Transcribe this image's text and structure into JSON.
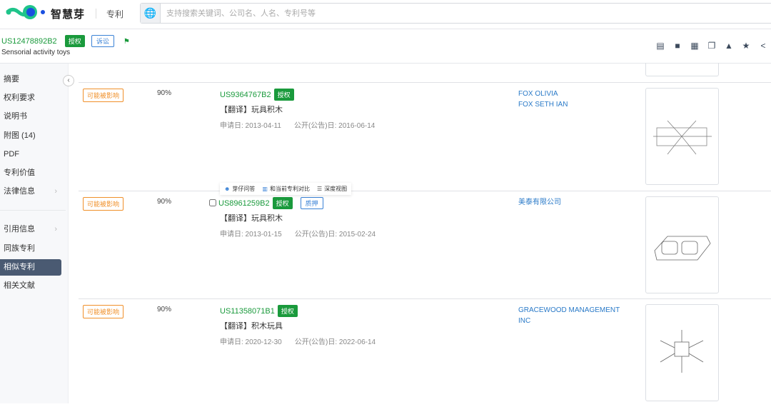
{
  "header": {
    "brand": "智慧芽",
    "nav": "专利",
    "search_placeholder": "支持搜索关键词、公司名、人名、专利号等"
  },
  "patent": {
    "number": "US12478892B2",
    "status": "授权",
    "badge": "诉讼",
    "title": "Sensorial activity toys"
  },
  "toolbar": [
    "pdf-download-icon",
    "folder-icon",
    "calendar-icon",
    "copy-icon",
    "upload-icon",
    "star-icon",
    "share-icon"
  ],
  "sidebar": {
    "items": [
      {
        "label": "摘要"
      },
      {
        "label": "权利要求"
      },
      {
        "label": "说明书"
      },
      {
        "label": "附图 (14)"
      },
      {
        "label": "PDF"
      },
      {
        "label": "专利价值"
      },
      {
        "label": "法律信息"
      },
      {
        "label": "引用信息"
      },
      {
        "label": "同族专利"
      },
      {
        "label": "相似专利"
      },
      {
        "label": "相关文献"
      }
    ]
  },
  "tooltip": {
    "qa": "芽仔问答",
    "compare": "和当前专利对比",
    "deep": "深度视图"
  },
  "results": [
    {
      "impact": "可能被影响",
      "similarity": "90%",
      "number": "US9364767B2",
      "status": "授权",
      "title": "【翻译】玩具积木",
      "app_date": "申请日: 2013-04-11",
      "pub_date": "公开(公告)日: 2016-06-14",
      "assignee": "FOX OLIVIA",
      "assignee2": "FOX SETH IAN"
    },
    {
      "impact": "可能被影响",
      "similarity": "90%",
      "number": "US8961259B2",
      "status": "授权",
      "badge": "质押",
      "title": "【翻译】玩具积木",
      "app_date": "申请日: 2013-01-15",
      "pub_date": "公开(公告)日: 2015-02-24",
      "assignee": "美泰有限公司"
    },
    {
      "impact": "可能被影响",
      "similarity": "90%",
      "number": "US11358071B1",
      "status": "授权",
      "title": "【翻译】积木玩具",
      "app_date": "申请日: 2020-12-30",
      "pub_date": "公开(公告)日: 2022-06-14",
      "assignee": "GRACEWOOD MANAGEMENT INC"
    }
  ]
}
